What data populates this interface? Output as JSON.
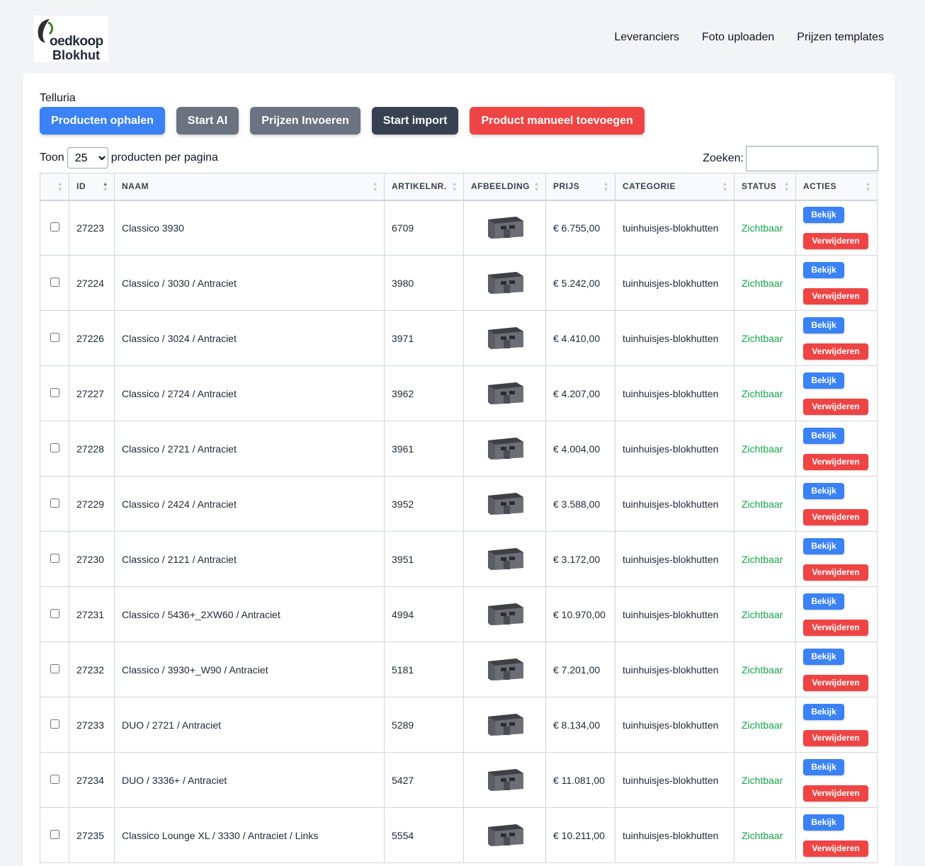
{
  "brand": {
    "line1": "oedkoop",
    "line2": "Blokhut"
  },
  "nav": [
    "Leveranciers",
    "Foto uploaden",
    "Prijzen templates"
  ],
  "supplier": "Telluria",
  "buttons": {
    "fetch": "Producten ophalen",
    "ai": "Start AI",
    "prices": "Prijzen Invoeren",
    "import": "Start import",
    "manual": "Product manueel toevoegen"
  },
  "paging": {
    "before": "Toon",
    "value": "25",
    "after": "producten per pagina"
  },
  "search": {
    "label": "Zoeken:"
  },
  "columns": [
    "ID",
    "NAAM",
    "ARTIKELNR.",
    "AFBEELDING",
    "PRIJS",
    "CATEGORIE",
    "STATUS",
    "ACTIES"
  ],
  "actions": {
    "view": "Bekijk",
    "delete": "Verwijderen"
  },
  "rows": [
    {
      "id": "27223",
      "name": "Classico 3930",
      "sku": "6709",
      "price": "€ 6.755,00",
      "category": "tuinhuisjes-blokhutten",
      "status": "Zichtbaar"
    },
    {
      "id": "27224",
      "name": "Classico / 3030 / Antraciet",
      "sku": "3980",
      "price": "€ 5.242,00",
      "category": "tuinhuisjes-blokhutten",
      "status": "Zichtbaar"
    },
    {
      "id": "27226",
      "name": "Classico / 3024 / Antraciet",
      "sku": "3971",
      "price": "€ 4.410,00",
      "category": "tuinhuisjes-blokhutten",
      "status": "Zichtbaar"
    },
    {
      "id": "27227",
      "name": "Classico / 2724 / Antraciet",
      "sku": "3962",
      "price": "€ 4.207,00",
      "category": "tuinhuisjes-blokhutten",
      "status": "Zichtbaar"
    },
    {
      "id": "27228",
      "name": "Classico / 2721 / Antraciet",
      "sku": "3961",
      "price": "€ 4.004,00",
      "category": "tuinhuisjes-blokhutten",
      "status": "Zichtbaar"
    },
    {
      "id": "27229",
      "name": "Classico / 2424 / Antraciet",
      "sku": "3952",
      "price": "€ 3.588,00",
      "category": "tuinhuisjes-blokhutten",
      "status": "Zichtbaar"
    },
    {
      "id": "27230",
      "name": "Classico / 2121 / Antraciet",
      "sku": "3951",
      "price": "€ 3.172,00",
      "category": "tuinhuisjes-blokhutten",
      "status": "Zichtbaar"
    },
    {
      "id": "27231",
      "name": "Classico / 5436+_2XW60 / Antraciet",
      "sku": "4994",
      "price": "€ 10.970,00",
      "category": "tuinhuisjes-blokhutten",
      "status": "Zichtbaar"
    },
    {
      "id": "27232",
      "name": "Classico / 3930+_W90 / Antraciet",
      "sku": "5181",
      "price": "€ 7.201,00",
      "category": "tuinhuisjes-blokhutten",
      "status": "Zichtbaar"
    },
    {
      "id": "27233",
      "name": "DUO / 2721 / Antraciet",
      "sku": "5289",
      "price": "€ 8.134,00",
      "category": "tuinhuisjes-blokhutten",
      "status": "Zichtbaar"
    },
    {
      "id": "27234",
      "name": "DUO / 3336+ / Antraciet",
      "sku": "5427",
      "price": "€ 11.081,00",
      "category": "tuinhuisjes-blokhutten",
      "status": "Zichtbaar"
    },
    {
      "id": "27235",
      "name": "Classico Lounge XL / 3330 / Antraciet / Links",
      "sku": "5554",
      "price": "€ 10.211,00",
      "category": "tuinhuisjes-blokhutten",
      "status": "Zichtbaar"
    }
  ]
}
